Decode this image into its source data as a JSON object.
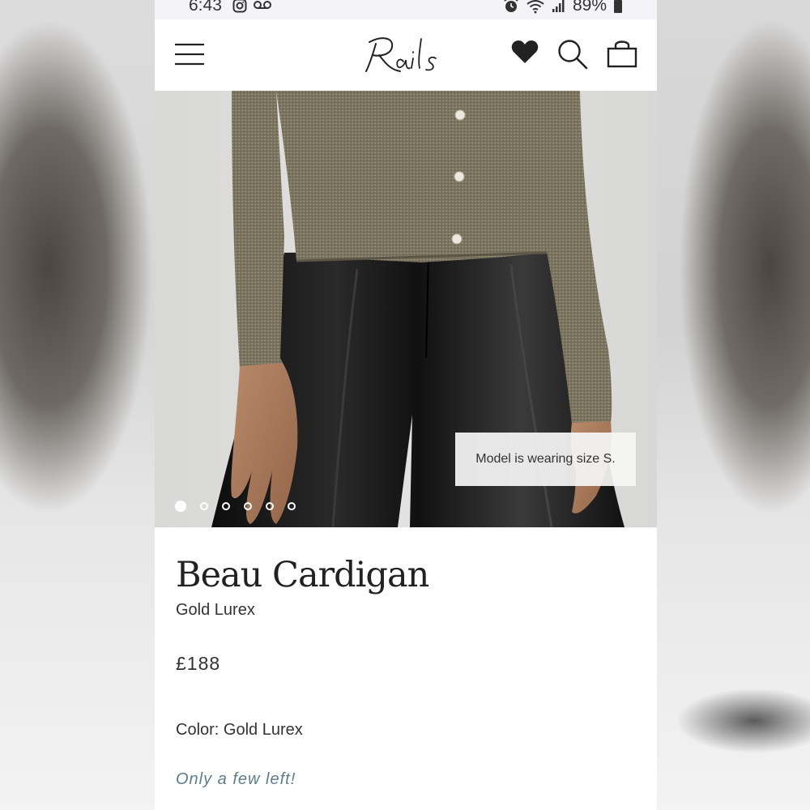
{
  "status_bar": {
    "time": "6:43",
    "battery": "89%",
    "icons": [
      "instagram-icon",
      "voicemail-icon",
      "alarm-icon",
      "wifi-icon",
      "signal-icon",
      "battery-icon"
    ]
  },
  "header": {
    "logo_text": "Rails",
    "icons": [
      "menu-icon",
      "heart-icon",
      "search-icon",
      "bag-icon"
    ]
  },
  "product": {
    "image_note": "Model is wearing size S.",
    "carousel": {
      "total": 6,
      "active": 1
    },
    "name": "Beau Cardigan",
    "variant": "Gold Lurex",
    "price": "£188",
    "color_label": "Color: Gold Lurex",
    "stock_message": "Only a few left!"
  },
  "colors": {
    "stock_text": "#5d7d8c",
    "cardigan": "#7d7560",
    "pants": "#1a1a1a"
  }
}
